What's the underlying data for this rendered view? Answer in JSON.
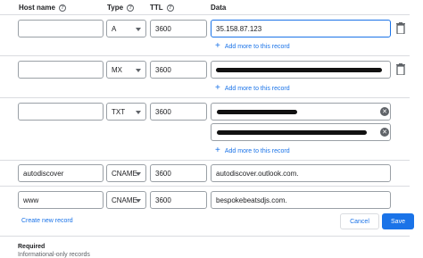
{
  "header": {
    "host_name": "Host name",
    "type": "Type",
    "ttl": "TTL",
    "data": "Data",
    "help_glyph": "?"
  },
  "records": [
    {
      "host": "",
      "type": "A",
      "ttl": "3600",
      "data": [
        "35.158.87.123"
      ],
      "add_more": "Add more to this record"
    },
    {
      "host": "",
      "type": "MX",
      "ttl": "3600",
      "data": [
        "[redacted]"
      ],
      "add_more": "Add more to this record"
    },
    {
      "host": "",
      "type": "TXT",
      "ttl": "3600",
      "data": [
        "[redacted]",
        "[redacted]"
      ],
      "add_more": "Add more to this record"
    },
    {
      "host": "autodiscover",
      "type": "CNAME",
      "ttl": "3600",
      "data": [
        "autodiscover.outlook.com."
      ]
    },
    {
      "host": "www",
      "type": "CNAME",
      "ttl": "3600",
      "data": [
        "bespokebeatsdjs.com."
      ]
    }
  ],
  "actions": {
    "create_new_record": "Create new record",
    "cancel": "Cancel",
    "save": "Save"
  },
  "footer": {
    "title": "Required",
    "subtitle": "Informational-only records"
  },
  "icons": {
    "add": "plus-icon",
    "delete": "trash-icon",
    "clear": "clear-icon",
    "help": "help-icon",
    "dropdown": "caret-down-icon"
  },
  "colors": {
    "accent": "#1a73e8",
    "border": "#9aa0a6",
    "text": "#202124"
  }
}
